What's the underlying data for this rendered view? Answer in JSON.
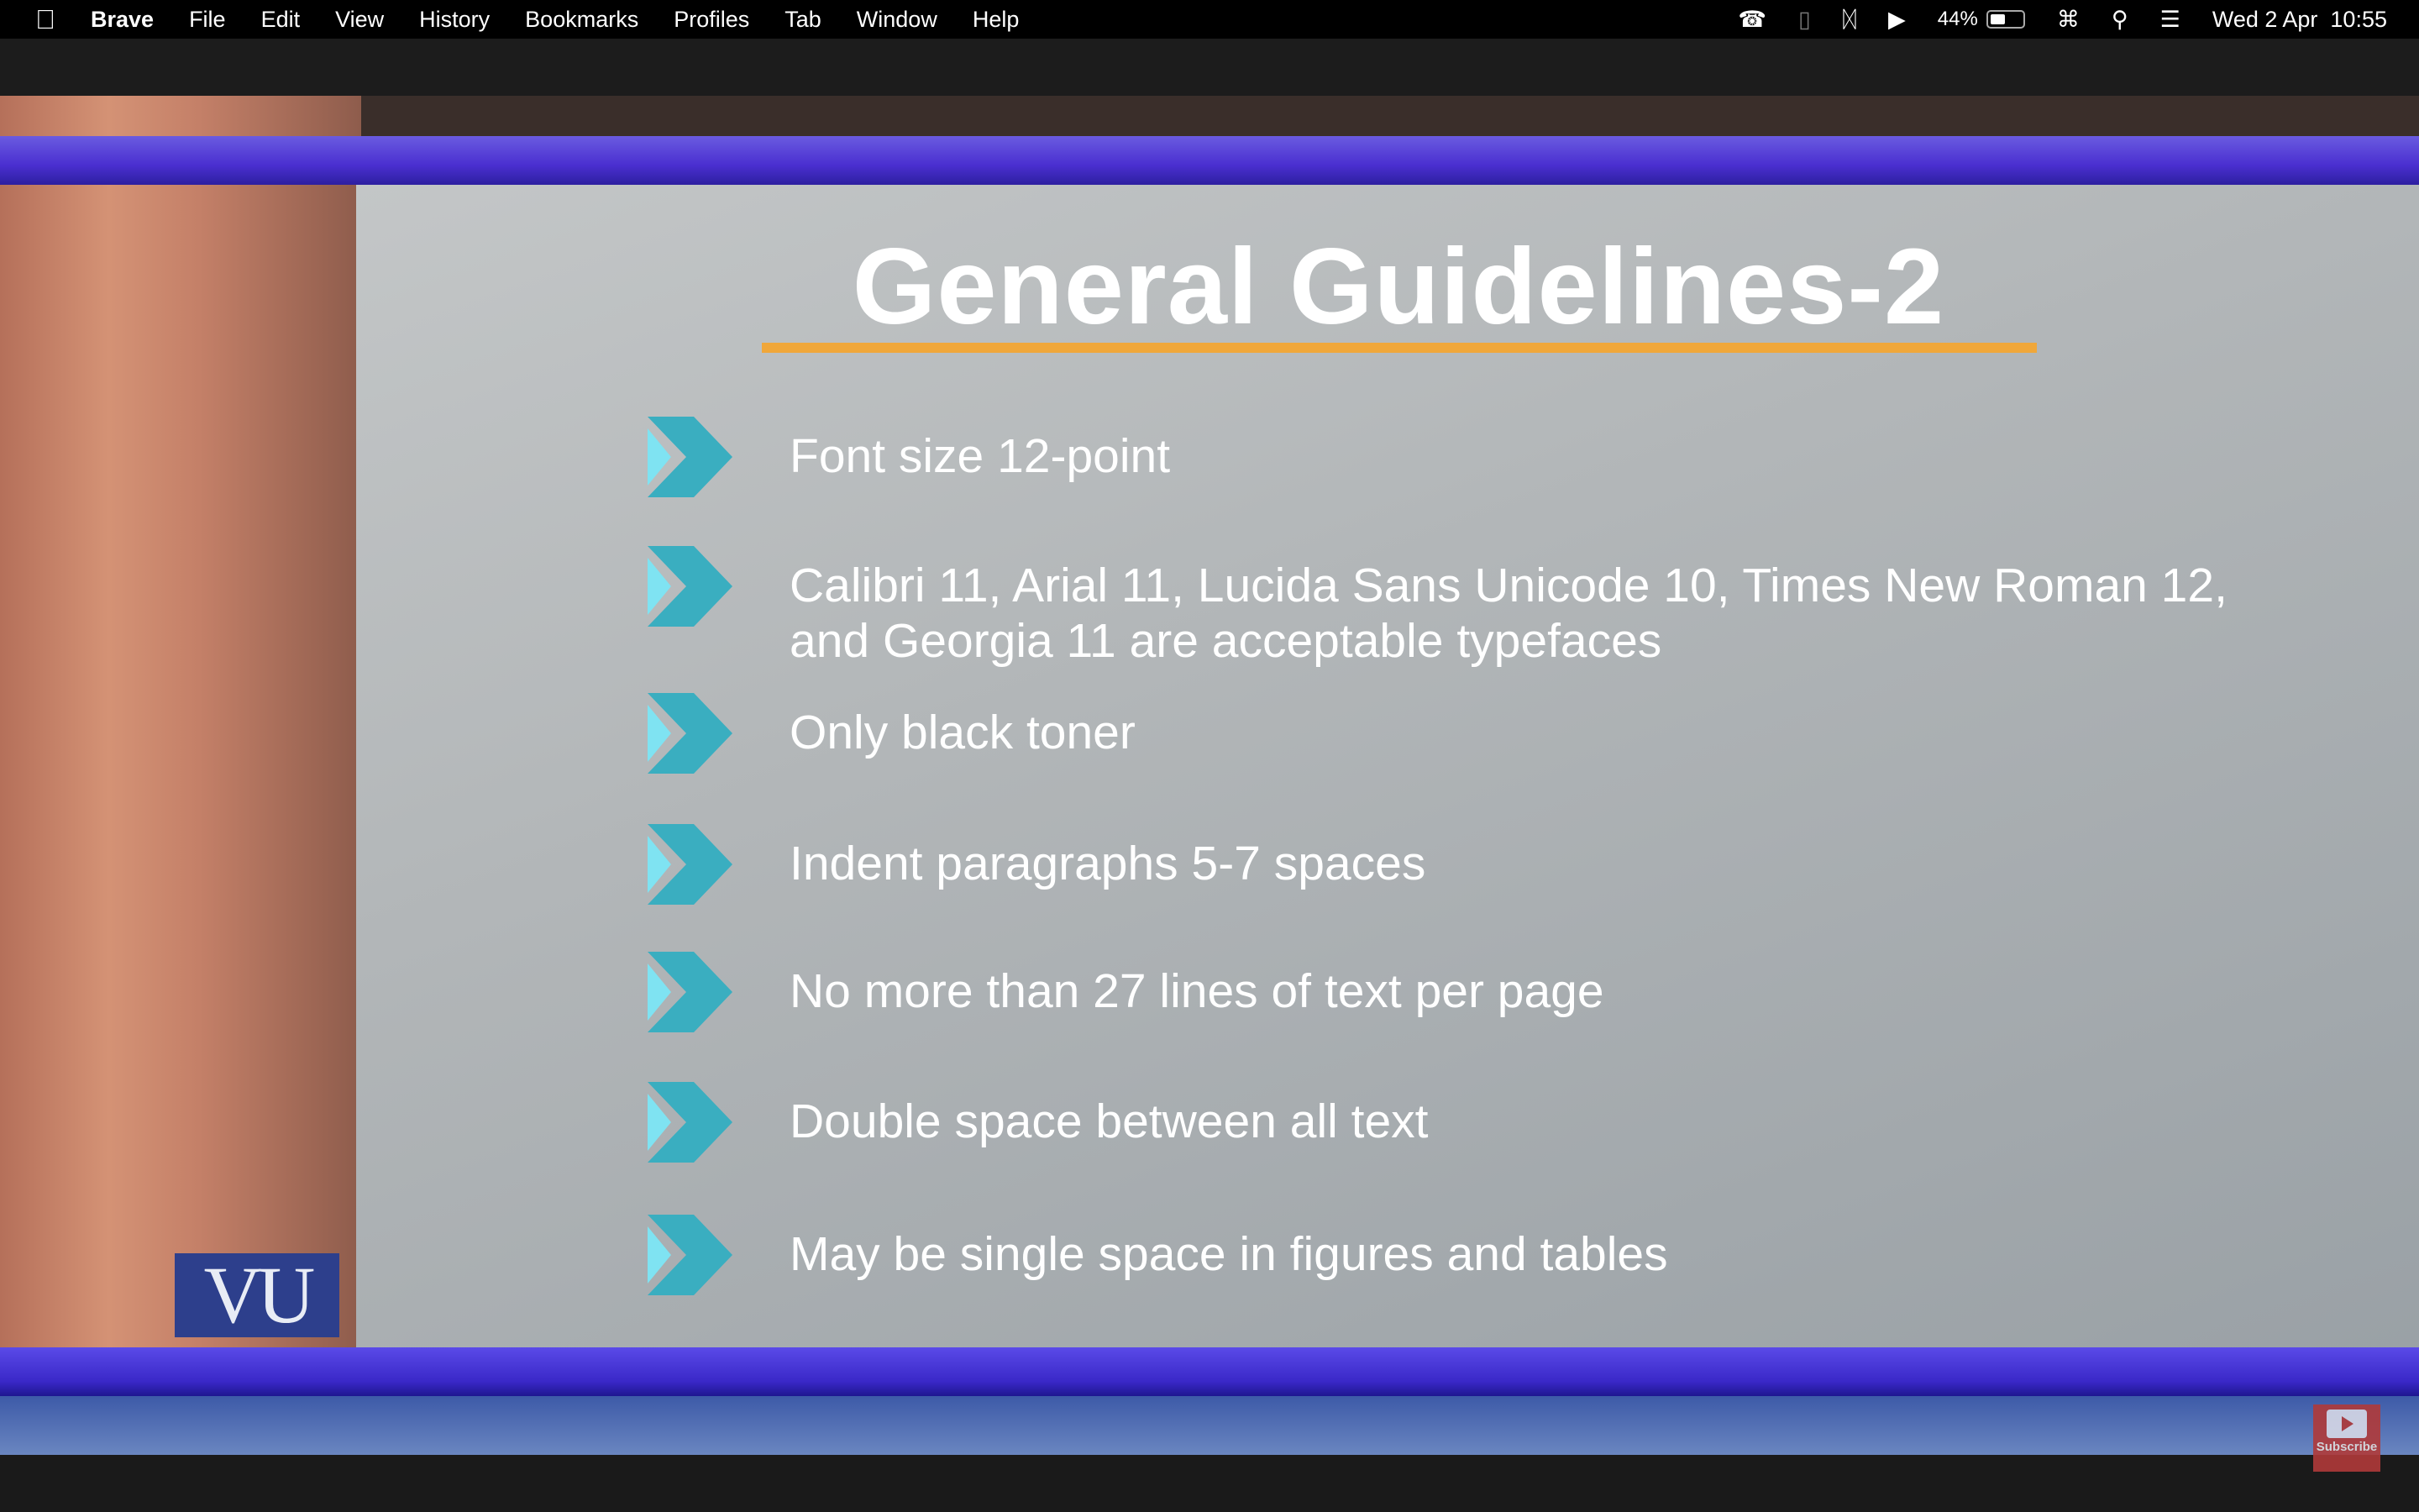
{
  "menubar": {
    "app": "Brave",
    "items": [
      "File",
      "Edit",
      "View",
      "History",
      "Bookmarks",
      "Profiles",
      "Tab",
      "Window",
      "Help"
    ],
    "status": {
      "battery": "44%",
      "datetime": "Wed 2 Apr  10:55",
      "icons": [
        "viber-icon",
        "sidebar-icon",
        "bluetooth-icon",
        "play-icon",
        "battery-icon",
        "wifi-icon",
        "search-icon",
        "control-center-icon"
      ]
    }
  },
  "slide": {
    "title": "General Guidelines-2",
    "accent": "#f0a73a",
    "bullet_color": "#3bbfcf",
    "bullets": [
      "Font size 12-point",
      "Calibri 11, Arial 11, Lucida Sans Unicode 10, Times New Roman 12,\nand Georgia 11 are acceptable typefaces",
      "Only black toner",
      "Indent paragraphs 5-7 spaces",
      "No more than 27 lines of text per page",
      "Double space between all text",
      "May be single space in figures and tables"
    ]
  },
  "logo": "VU",
  "subscribe": "Subscribe"
}
